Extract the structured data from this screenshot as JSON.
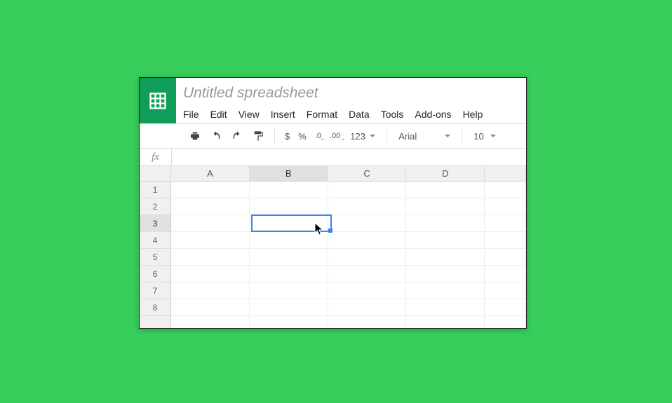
{
  "app": {
    "title": "Untitled spreadsheet"
  },
  "menu": {
    "file": "File",
    "edit": "Edit",
    "view": "View",
    "insert": "Insert",
    "format": "Format",
    "data": "Data",
    "tools": "Tools",
    "addons": "Add-ons",
    "help": "Help"
  },
  "toolbar": {
    "currency": "$",
    "percent": "%",
    "dec_minus": ".0",
    "dec_plus": ".00",
    "numfmt": "123",
    "font_name": "Arial",
    "font_size": "10"
  },
  "formula": {
    "fx": "fx",
    "value": ""
  },
  "grid": {
    "columns": [
      "A",
      "B",
      "C",
      "D"
    ],
    "rows": [
      "1",
      "2",
      "3",
      "4",
      "5",
      "6",
      "7",
      "8"
    ],
    "selected_cell": "B3"
  }
}
